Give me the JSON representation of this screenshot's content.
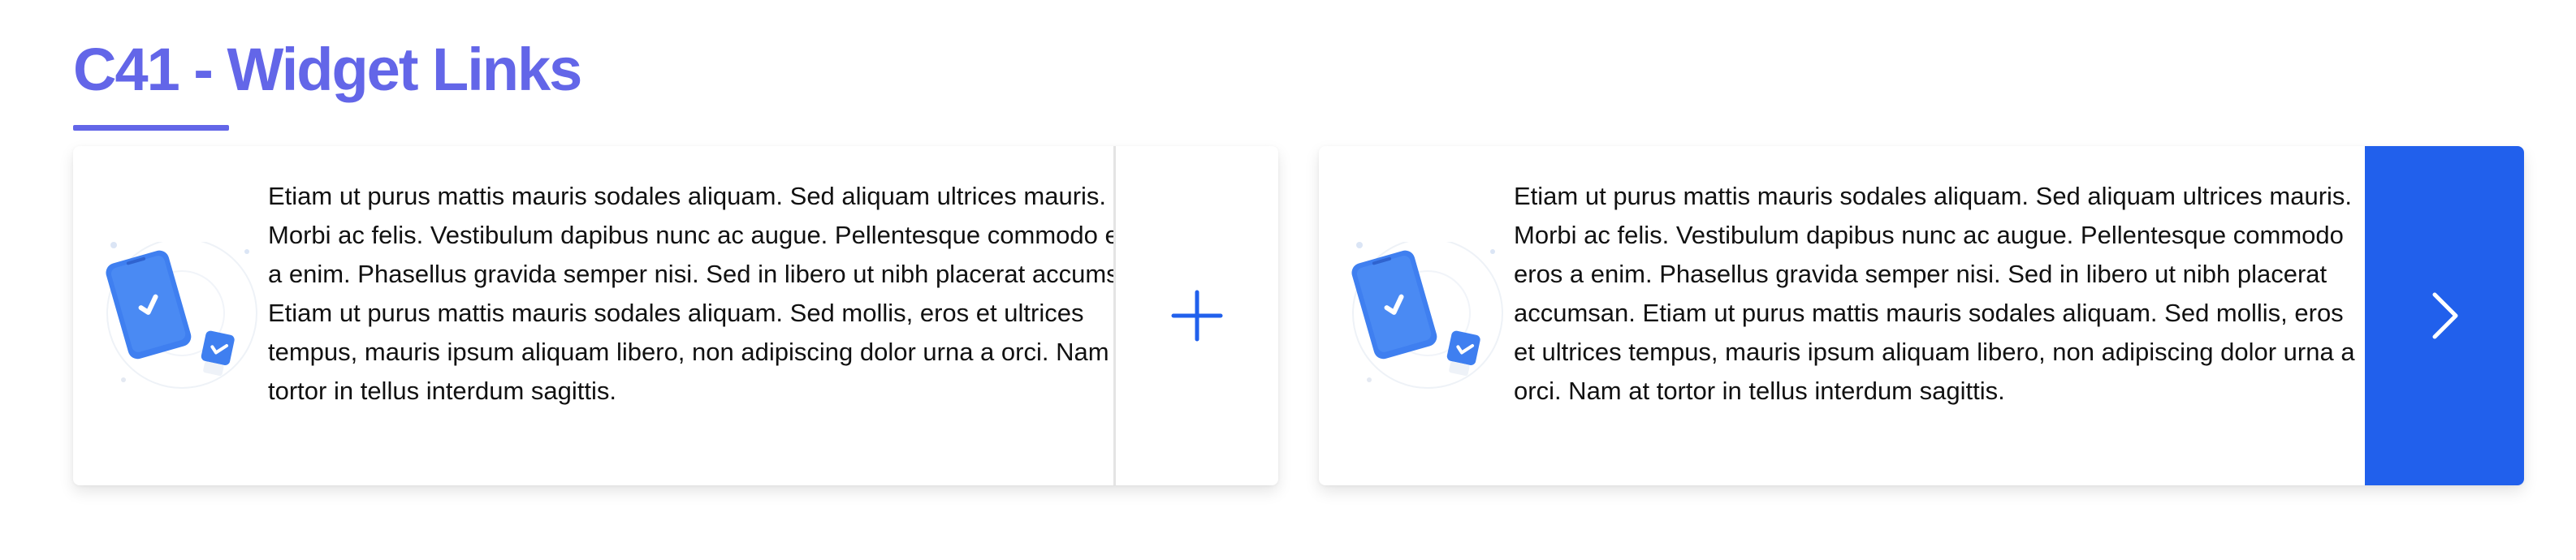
{
  "page": {
    "title": "C41 - Widget Links"
  },
  "widgets": [
    {
      "text": "Etiam ut purus mattis mauris sodales aliquam. Sed aliquam ultrices mauris. Morbi ac felis. Vestibulum dapibus nunc ac augue. Pellentesque commodo eros a enim. Phasellus gravida semper nisi. Sed in libero ut nibh placerat accumsan. Etiam ut purus mattis mauris sodales aliquam. Sed mollis, eros et ultrices tempus, mauris ipsum aliquam libero, non adipiscing dolor urna a orci. Nam at tortor in tellus interdum sagittis.",
      "illustration": "phone-checkmark-illustration",
      "action_icon": "plus-icon",
      "action_color": "#2160ec",
      "action_background": "#ffffff"
    },
    {
      "text": "Etiam ut purus mattis mauris sodales aliquam. Sed aliquam ultrices mauris. Morbi ac felis. Vestibulum dapibus nunc ac augue. Pellentesque commodo eros a enim. Phasellus gravida semper nisi. Sed in libero ut nibh placerat accumsan. Etiam ut purus mattis mauris sodales aliquam. Sed mollis, eros et ultrices tempus, mauris ipsum aliquam libero, non adipiscing dolor urna a orci. Nam at tortor in tellus interdum sagittis.",
      "illustration": "phone-checkmark-illustration",
      "action_icon": "chevron-right-icon",
      "action_color": "#ffffff",
      "action_background": "#2160ec"
    }
  ],
  "colors": {
    "title": "#6366e8",
    "accent_blue": "#2160ec",
    "illustration_blue": "#3f7ff0"
  }
}
